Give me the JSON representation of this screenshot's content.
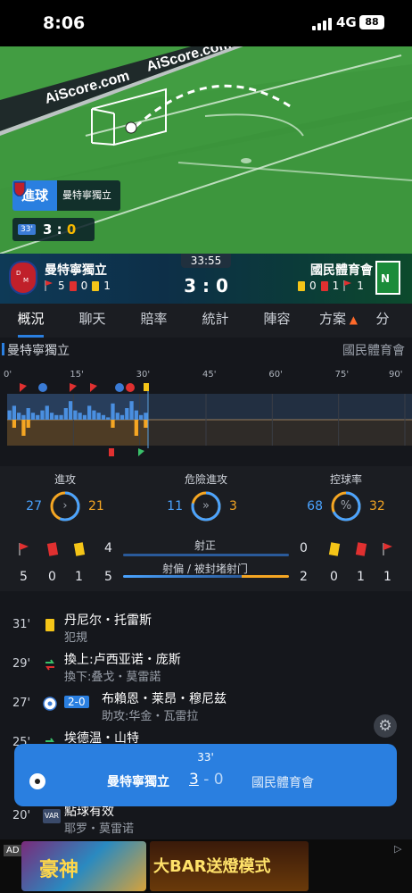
{
  "status_bar": {
    "time": "8:06",
    "network": "4G",
    "battery": "88"
  },
  "field": {
    "watermark": "AiScore.com",
    "goal_label": "進球",
    "goal_team": "曼特寧獨立",
    "mini_minute": "33'",
    "mini_home": "3",
    "mini_sep": ":",
    "mini_away": "0"
  },
  "match": {
    "clock": "33:55",
    "home_name": "曼特寧獨立",
    "away_name": "國民體育會",
    "score": "3 : 0",
    "home_corners": "5",
    "home_reds": "0",
    "home_yellows": "1",
    "away_yellows": "0",
    "away_reds": "1",
    "away_corners": "1"
  },
  "tabs": [
    "概況",
    "聊天",
    "賠率",
    "統計",
    "陣容",
    "方案",
    "分"
  ],
  "timeline": {
    "home_label": "曼特寧獨立",
    "away_label": "國民體育會",
    "minute_marks": [
      "0'",
      "15'",
      "30'",
      "45'",
      "60'",
      "75'",
      "90'"
    ],
    "home_pressure": [
      4,
      6,
      3,
      2,
      5,
      3,
      2,
      4,
      6,
      3,
      2,
      2,
      5,
      8,
      4,
      3,
      2,
      6,
      4,
      3,
      2,
      1,
      7,
      3,
      2,
      5,
      8,
      4,
      2,
      3
    ],
    "away_pressure": [
      0,
      1,
      0,
      2,
      1,
      0,
      0,
      0,
      0,
      0,
      0,
      0,
      0,
      0,
      0,
      0,
      0,
      0,
      0,
      0,
      0,
      0,
      1,
      0,
      0,
      0,
      0,
      2,
      0,
      1
    ]
  },
  "stats": {
    "attacks": {
      "label": "進攻",
      "home": "27",
      "away": "21",
      "home_share": 0.5625
    },
    "dangerous": {
      "label": "危險進攻",
      "home": "11",
      "away": "3",
      "home_share": 0.7857
    },
    "possession": {
      "label": "控球率",
      "home": "68",
      "away": "32",
      "home_share": 0.68
    },
    "shots_on": {
      "label": "射正",
      "home": "4",
      "away": "0"
    },
    "shots_off": {
      "label": "射偏 / 被封堵射门",
      "home": "5",
      "away": "2"
    },
    "home_corners": "5",
    "home_reds": "0",
    "home_yellows": "1",
    "away_yellows": "0",
    "away_reds": "1",
    "away_corners": "1",
    "home_color": "#4aa3ff",
    "away_color": "#f5a623"
  },
  "events": [
    {
      "minute": "31'",
      "icon": "yellow-card-icon",
      "line1": "丹尼尔・托雷斯",
      "line2": "犯規"
    },
    {
      "minute": "29'",
      "icon": "substitution-icon",
      "line1": "換上:卢西亚诺・庞斯",
      "line2": "換下:叠戈・莫雷諾"
    },
    {
      "minute": "27'",
      "icon": "goal-icon",
      "badge": "2-0",
      "line1": "布賴恩・莱昂・穆尼兹",
      "line2": "助攻:华金・瓦雷拉"
    },
    {
      "minute": "25'",
      "icon": "substitution-icon",
      "line1": "埃德温・山特",
      "line2": ""
    },
    {
      "minute": "20'",
      "icon": "var-icon",
      "line1": "點球有效",
      "line2": "耶罗・莫雷诺"
    }
  ],
  "notification": {
    "minute": "33'",
    "home": "曼特寧獨立",
    "home_score": "3",
    "sep": "-",
    "away_score": "0",
    "away": "國民體育會"
  },
  "ad": {
    "tag": "AD",
    "text1": "豪神",
    "text2": "大BAR送燈模式"
  }
}
